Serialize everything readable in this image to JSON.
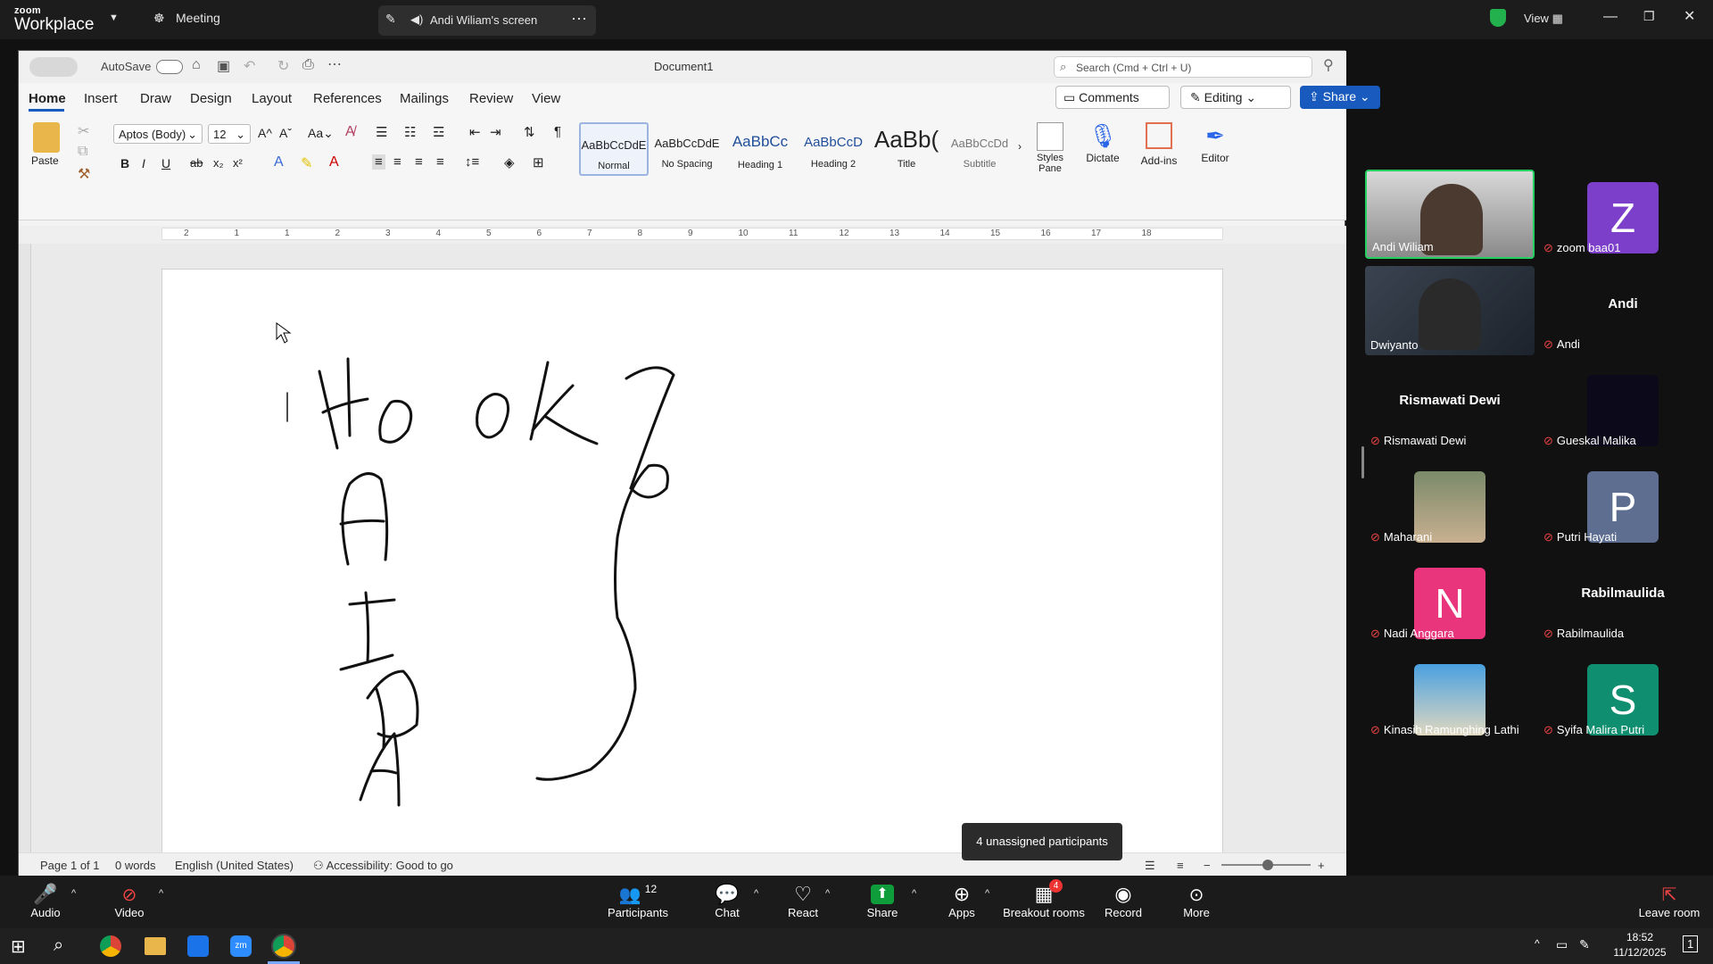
{
  "zoom": {
    "logo_top": "zoom",
    "logo_bottom": "Workplace",
    "meeting_label": "Meeting",
    "share_tab": "Andi Wiliam's screen",
    "view_label": "View"
  },
  "word": {
    "autosave": "AutoSave",
    "doc_title": "Document1",
    "search_placeholder": "Search (Cmd + Ctrl + U)",
    "tabs": [
      "Home",
      "Insert",
      "Draw",
      "Design",
      "Layout",
      "References",
      "Mailings",
      "Review",
      "View"
    ],
    "comments": "Comments",
    "editing": "Editing",
    "share": "Share",
    "font_name": "Aptos (Body)",
    "font_size": "12",
    "paste": "Paste",
    "styles": [
      {
        "preview": "AaBbCcDdE",
        "name": "Normal"
      },
      {
        "preview": "AaBbCcDdE",
        "name": "No Spacing"
      },
      {
        "preview": "AaBbCc",
        "name": "Heading 1"
      },
      {
        "preview": "AaBbCcD",
        "name": "Heading 2"
      },
      {
        "preview": "AaBb(",
        "name": "Title"
      },
      {
        "preview": "AaBbCcDd",
        "name": "Subtitle"
      }
    ],
    "styles_pane": "Styles Pane",
    "dictate": "Dictate",
    "addins": "Add-ins",
    "editor": "Editor",
    "ruler_marks": [
      "2",
      "1",
      "1",
      "2",
      "3",
      "4",
      "5",
      "6",
      "7",
      "8",
      "9",
      "10",
      "11",
      "12",
      "13",
      "14",
      "15",
      "16",
      "17",
      "18"
    ],
    "status": {
      "page": "Page 1 of 1",
      "words": "0 words",
      "language": "English (United States)",
      "accessibility": "Accessibility: Good to go"
    }
  },
  "tooltip": "4 unassigned participants",
  "participants": [
    {
      "name": "Andi Wiliam",
      "type": "video",
      "muted": false
    },
    {
      "name": "zoom baa01",
      "type": "avatar",
      "letter": "Z",
      "color": "#7b3fc9",
      "muted": true
    },
    {
      "name": "Dwiyanto",
      "type": "video",
      "muted": false
    },
    {
      "name": "Andi",
      "type": "name",
      "big": "Andi",
      "muted": true
    },
    {
      "name": "Rismawati Dewi",
      "type": "name",
      "big": "Rismawati Dewi",
      "muted": true
    },
    {
      "name": "Gueskal Malika",
      "type": "dark",
      "muted": true
    },
    {
      "name": "Maharani",
      "type": "photo",
      "muted": true
    },
    {
      "name": "Putri Hayati",
      "type": "avatar",
      "letter": "P",
      "color": "#5e6e90",
      "muted": true
    },
    {
      "name": "Nadi Anggara",
      "type": "avatar",
      "letter": "N",
      "color": "#e8357c",
      "muted": true
    },
    {
      "name": "Rabilmaulida",
      "type": "name",
      "big": "Rabilmaulida",
      "muted": true
    },
    {
      "name": "Kinasih Ramunghing Lathi",
      "type": "photo2",
      "muted": true
    },
    {
      "name": "Syifa Malira Putri",
      "type": "avatar",
      "letter": "S",
      "color": "#0f8f6f",
      "muted": true
    }
  ],
  "toolbar": {
    "audio": "Audio",
    "video": "Video",
    "participants": "Participants",
    "participants_count": "12",
    "chat": "Chat",
    "react": "React",
    "share": "Share",
    "apps": "Apps",
    "breakout": "Breakout rooms",
    "breakout_badge": "4",
    "record": "Record",
    "more": "More",
    "leave": "Leave room"
  },
  "taskbar": {
    "time": "18:52",
    "date": "11/12/2025",
    "notif": "1"
  },
  "colors": {
    "accent": "#2b66e8",
    "word_blue": "#185abd",
    "share_green": "#0e9d3a",
    "muted_red": "#e44"
  }
}
